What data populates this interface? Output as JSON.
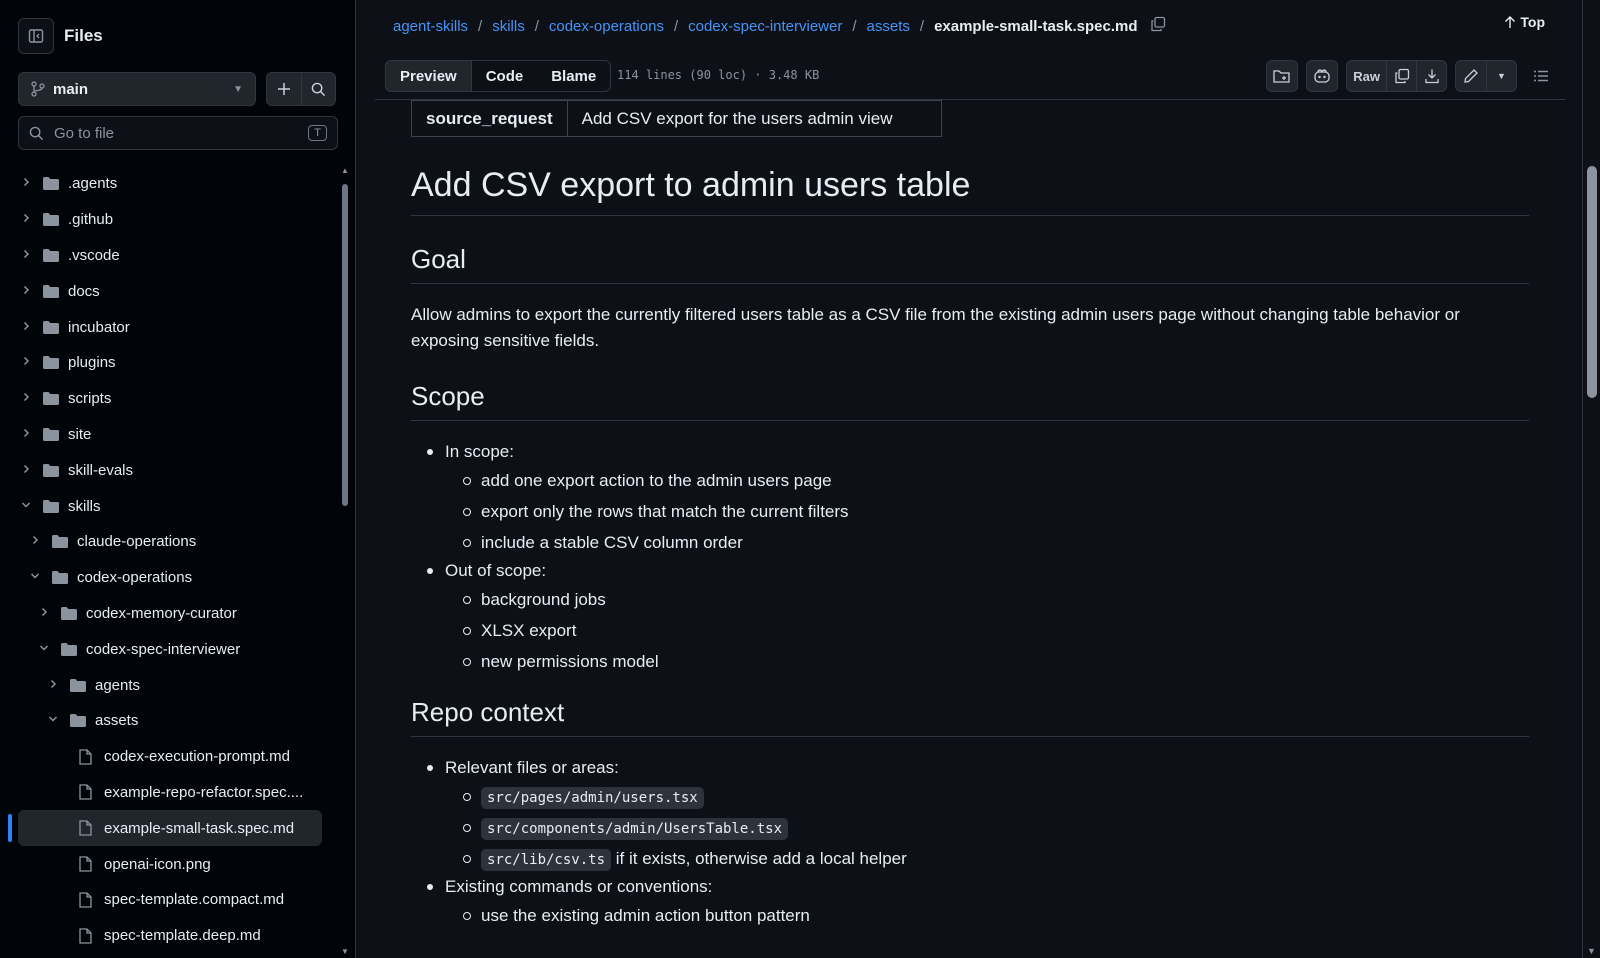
{
  "sidebar": {
    "title": "Files",
    "branch": "main",
    "goto_placeholder": "Go to file",
    "goto_shortcut": "T",
    "tree": [
      {
        "name": ".agents",
        "type": "folder",
        "depth": 0,
        "open": false
      },
      {
        "name": ".github",
        "type": "folder",
        "depth": 0,
        "open": false
      },
      {
        "name": ".vscode",
        "type": "folder",
        "depth": 0,
        "open": false
      },
      {
        "name": "docs",
        "type": "folder",
        "depth": 0,
        "open": false
      },
      {
        "name": "incubator",
        "type": "folder",
        "depth": 0,
        "open": false
      },
      {
        "name": "plugins",
        "type": "folder",
        "depth": 0,
        "open": false
      },
      {
        "name": "scripts",
        "type": "folder",
        "depth": 0,
        "open": false
      },
      {
        "name": "site",
        "type": "folder",
        "depth": 0,
        "open": false
      },
      {
        "name": "skill-evals",
        "type": "folder",
        "depth": 0,
        "open": false
      },
      {
        "name": "skills",
        "type": "folder",
        "depth": 0,
        "open": true
      },
      {
        "name": "claude-operations",
        "type": "folder",
        "depth": 1,
        "open": false
      },
      {
        "name": "codex-operations",
        "type": "folder",
        "depth": 1,
        "open": true
      },
      {
        "name": "codex-memory-curator",
        "type": "folder",
        "depth": 2,
        "open": false
      },
      {
        "name": "codex-spec-interviewer",
        "type": "folder",
        "depth": 2,
        "open": true
      },
      {
        "name": "agents",
        "type": "folder",
        "depth": 3,
        "open": false
      },
      {
        "name": "assets",
        "type": "folder",
        "depth": 3,
        "open": true
      },
      {
        "name": "codex-execution-prompt.md",
        "type": "file",
        "depth": 4
      },
      {
        "name": "example-repo-refactor.spec....",
        "type": "file",
        "depth": 4
      },
      {
        "name": "example-small-task.spec.md",
        "type": "file",
        "depth": 4,
        "selected": true
      },
      {
        "name": "openai-icon.png",
        "type": "file",
        "depth": 4
      },
      {
        "name": "spec-template.compact.md",
        "type": "file",
        "depth": 4
      },
      {
        "name": "spec-template.deep.md",
        "type": "file",
        "depth": 4
      }
    ]
  },
  "breadcrumb": {
    "links": [
      "agent-skills",
      "skills",
      "codex-operations",
      "codex-spec-interviewer",
      "assets"
    ],
    "current": "example-small-task.spec.md"
  },
  "top_label": "Top",
  "toolbar": {
    "tabs": [
      "Preview",
      "Code",
      "Blame"
    ],
    "active_tab": "Preview",
    "meta": "114 lines (90 loc) · 3.48 KB",
    "raw_label": "Raw"
  },
  "doc": {
    "meta_key": "source_request",
    "meta_value": "Add CSV export for the users admin view",
    "title": "Add CSV export to admin users table",
    "goal_heading": "Goal",
    "goal_text": "Allow admins to export the currently filtered users table as a CSV file from the existing admin users page without changing table behavior or exposing sensitive fields.",
    "scope_heading": "Scope",
    "in_scope_label": "In scope:",
    "in_scope": [
      "add one export action to the admin users page",
      "export only the rows that match the current filters",
      "include a stable CSV column order"
    ],
    "out_scope_label": "Out of scope:",
    "out_scope": [
      "background jobs",
      "XLSX export",
      "new permissions model"
    ],
    "repo_heading": "Repo context",
    "files_label": "Relevant files or areas:",
    "files": [
      "src/pages/admin/users.tsx",
      "src/components/admin/UsersTable.tsx",
      "src/lib/csv.ts"
    ],
    "file3_suffix": "if it exists, otherwise add a local helper",
    "conventions_label": "Existing commands or conventions:",
    "conventions": [
      "use the existing admin action button pattern"
    ]
  }
}
